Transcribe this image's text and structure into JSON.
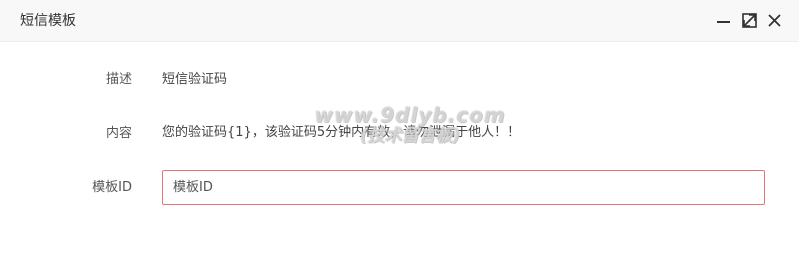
{
  "window": {
    "title": "短信模板"
  },
  "form": {
    "description_label": "描述",
    "description_value": "短信验证码",
    "content_label": "内容",
    "content_value": "您的验证码{1}，该验证码5分钟内有效，请勿泄漏于他人！！",
    "template_id_label": "模板ID",
    "template_id_placeholder": "模板ID",
    "template_id_value": ""
  },
  "watermark": {
    "line1": "www.9dlyb.com",
    "line2": "(技术留言板)"
  },
  "colors": {
    "titlebar_bg": "#f8f8f8",
    "input_border_error": "#e57373"
  },
  "icons": {
    "minimize": "minimize-icon",
    "maximize": "maximize-icon",
    "close": "close-icon"
  }
}
